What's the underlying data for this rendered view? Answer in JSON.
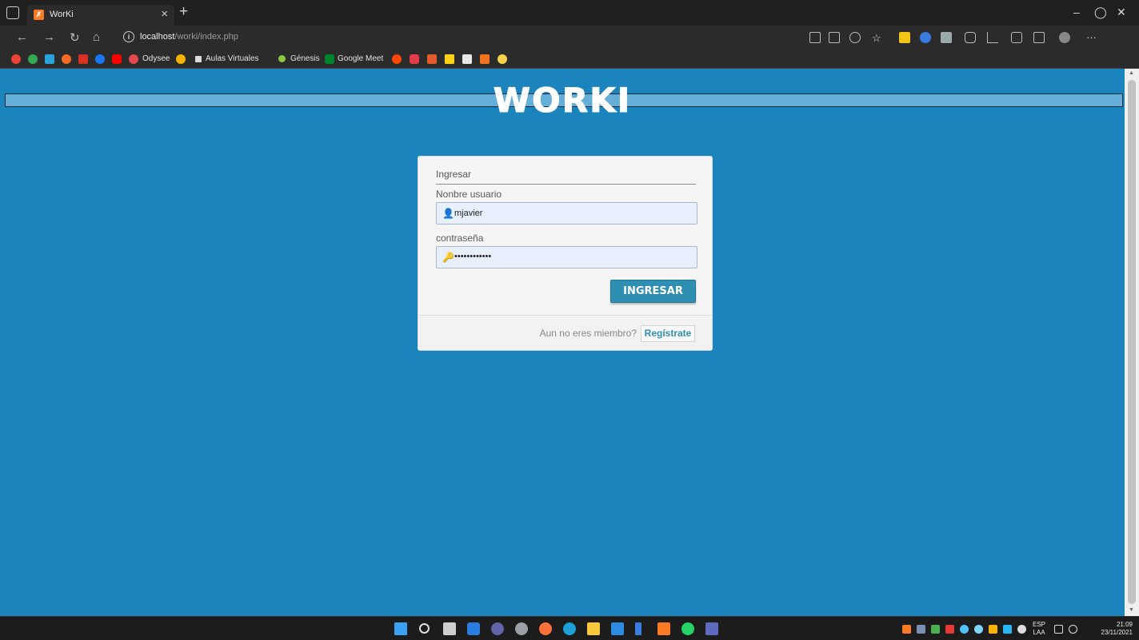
{
  "browser": {
    "tab_title": "WorKi",
    "address_host": "localhost",
    "address_path": "/worki/index.php",
    "bookmarks": [
      "Odysee",
      "Aulas Virtuales",
      "Génesis",
      "Google Meet"
    ]
  },
  "page": {
    "brand": "WORKI",
    "login": {
      "heading": "Ingresar",
      "username_label": "Nonbre usuario",
      "username_value": "mjavier",
      "password_label": "contraseña",
      "password_value": "••••••••••••",
      "submit_label": "INGRESAR",
      "not_member_text": "Aun no eres miembro?",
      "register_label": "Regístrate"
    }
  },
  "taskbar": {
    "lang_primary": "ESP",
    "lang_secondary": "LAA",
    "time": "21:09",
    "date": "23/11/2021"
  },
  "colors": {
    "page_bg": "#1b84bd",
    "band": "#64aed8",
    "button": "#2f8fb2"
  }
}
